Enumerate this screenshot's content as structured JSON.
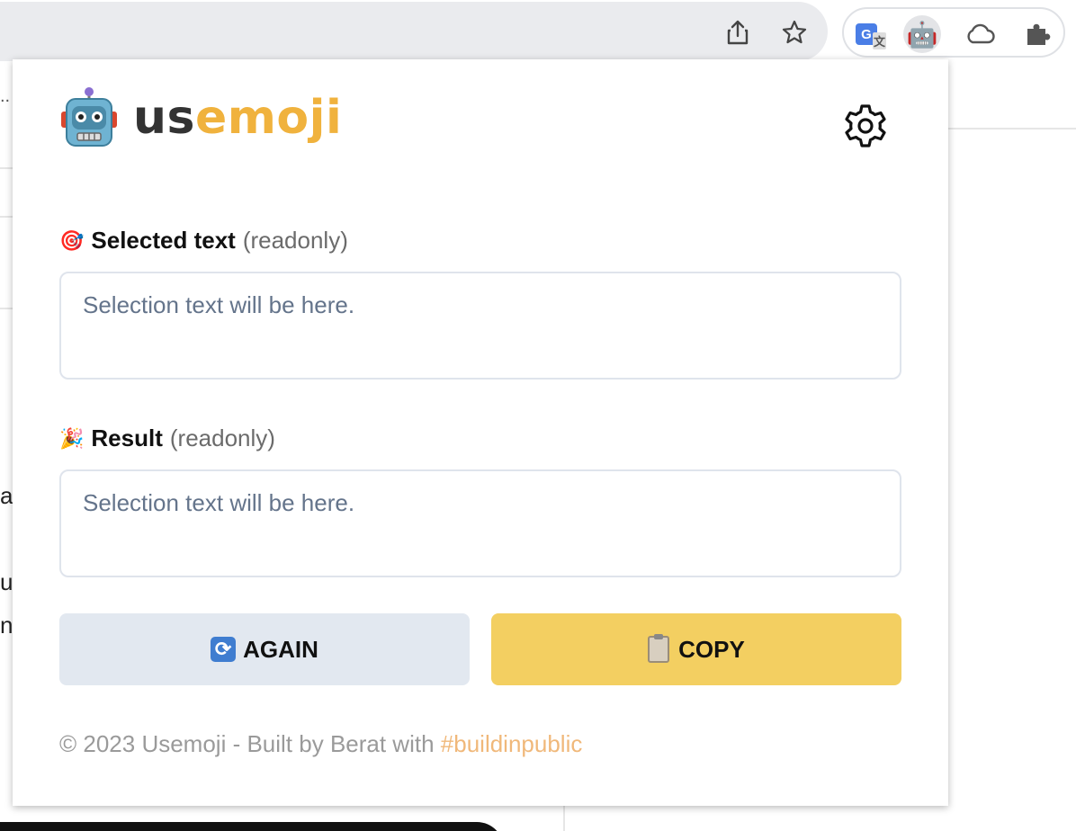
{
  "browser": {
    "share_icon": "share-icon",
    "bookmark_icon": "star-icon",
    "extensions": [
      {
        "name": "google-translate",
        "glyph": "G"
      },
      {
        "name": "usemoji",
        "glyph": "🤖"
      },
      {
        "name": "cloud",
        "glyph": "cloud-icon"
      },
      {
        "name": "extensions-puzzle",
        "glyph": "puzzle-icon"
      }
    ]
  },
  "background_page": {
    "ellipsis": "..",
    "chars": [
      "a",
      "u",
      "n"
    ]
  },
  "popup": {
    "logo": {
      "robot": "🤖",
      "text_part1": "us",
      "text_part2": "emoji"
    },
    "settings_icon": "gear-icon",
    "selected": {
      "icon": "🎯",
      "label": "Selected text",
      "sublabel": "(readonly)",
      "placeholder": "Selection text will be here."
    },
    "result": {
      "icon": "🎉",
      "label": "Result",
      "sublabel": "(readonly)",
      "placeholder": "Selection text will be here."
    },
    "again_button": {
      "icon": "🔄",
      "label": "AGAIN"
    },
    "copy_button": {
      "icon": "📋",
      "label": "COPY"
    },
    "footer": {
      "text": "© 2023 Usemoji - Built by Berat with ",
      "link": "#buildinpublic"
    }
  },
  "colors": {
    "accent": "#f0b23d",
    "copy_button": "#f3cf61",
    "again_button": "#e2e8f0",
    "link": "#f0b87a"
  }
}
